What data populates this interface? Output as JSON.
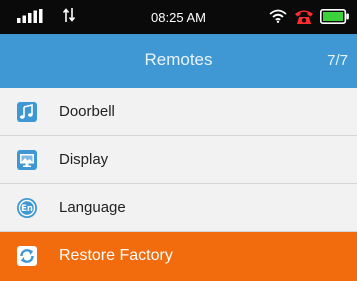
{
  "status_bar": {
    "time": "08:25 AM"
  },
  "header": {
    "title": "Remotes",
    "count": "7/7"
  },
  "menu": {
    "items": [
      {
        "label": "Doorbell",
        "icon": "music-note-icon",
        "selected": false
      },
      {
        "label": "Display",
        "icon": "monitor-display-icon",
        "selected": false
      },
      {
        "label": "Language",
        "icon": "language-en-icon",
        "selected": false
      },
      {
        "label": "Restore Factory",
        "icon": "refresh-icon",
        "selected": true
      }
    ]
  },
  "colors": {
    "title_bar": "#3f97d3",
    "selected_row": "#f26c0d",
    "status_bar": "#0a0a0a",
    "battery": "#3bd23b",
    "phone_icon": "#ff2d2d"
  }
}
